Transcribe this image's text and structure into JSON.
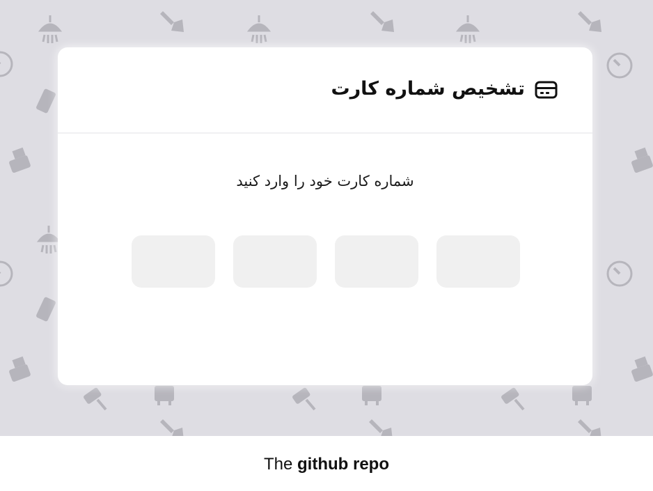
{
  "card": {
    "title": "تشخیص شماره کارت",
    "icon": "credit-card-icon",
    "prompt": "شماره کارت خود را وارد کنید"
  },
  "inputs": [
    {
      "value": "",
      "placeholder": ""
    },
    {
      "value": "",
      "placeholder": ""
    },
    {
      "value": "",
      "placeholder": ""
    },
    {
      "value": "",
      "placeholder": ""
    }
  ],
  "footer": {
    "prefix": "The",
    "link_label": "github repo"
  },
  "colors": {
    "background_pattern": "#dedde3",
    "card": "#ffffff",
    "input_fill": "#f0f0f0",
    "text": "#111111"
  },
  "background_icons": [
    "shower-icon",
    "trowel-icon",
    "phone-icon",
    "gauge-icon",
    "paint-roller-icon",
    "heater-icon",
    "wrench-icon",
    "printer-icon"
  ]
}
